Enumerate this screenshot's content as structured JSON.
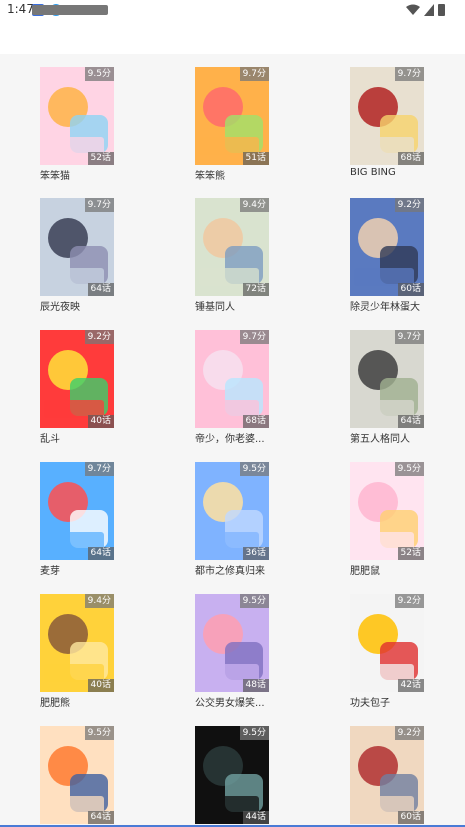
{
  "status_bar": {
    "time": "1:47",
    "app_icons": [
      "mail-icon",
      "bird-icon",
      "card-icon"
    ],
    "right_icons": [
      "wifi-icon",
      "signal-icon",
      "battery-icon"
    ]
  },
  "comics": [
    {
      "title": "笨笨猫",
      "score": "9.5分",
      "episodes": "52话",
      "colors": [
        "#ffd4e4",
        "#ffb347",
        "#8fd3f4"
      ]
    },
    {
      "title": "笨笨熊",
      "score": "9.7分",
      "episodes": "51话",
      "colors": [
        "#ffb14a",
        "#ff6b6b",
        "#a0e26a"
      ]
    },
    {
      "title": "BIG BING",
      "score": "9.7分",
      "episodes": "68话",
      "colors": [
        "#e8e0d0",
        "#b22222",
        "#f6d36b"
      ]
    },
    {
      "title": "辰光夜映",
      "score": "9.7分",
      "episodes": "64话",
      "colors": [
        "#c7d2e0",
        "#3a3f55",
        "#8d8fb2"
      ]
    },
    {
      "title": "锤基同人",
      "score": "9.4分",
      "episodes": "72话",
      "colors": [
        "#d9e3cf",
        "#f0c8a0",
        "#7d9cc1"
      ]
    },
    {
      "title": "除灵少年林蛋大",
      "score": "9.2分",
      "episodes": "60话",
      "colors": [
        "#5a7ac0",
        "#f0d0b0",
        "#303a55"
      ]
    },
    {
      "title": "乱斗",
      "score": "9.2分",
      "episodes": "40话",
      "colors": [
        "#ff3b3b",
        "#ffe23a",
        "#3ad16b"
      ]
    },
    {
      "title": "帝少，你老婆...",
      "score": "9.7分",
      "episodes": "68话",
      "colors": [
        "#ffc0d8",
        "#f7e0f0",
        "#b8e6ff"
      ]
    },
    {
      "title": "第五人格同人",
      "score": "9.7分",
      "episodes": "64话",
      "colors": [
        "#d8d8d0",
        "#404040",
        "#a0b090"
      ]
    },
    {
      "title": "麦芽",
      "score": "9.7分",
      "episodes": "64话",
      "colors": [
        "#58b0ff",
        "#ff5050",
        "#ffffff"
      ]
    },
    {
      "title": "都市之修真归来",
      "score": "9.5分",
      "episodes": "36话",
      "colors": [
        "#7fb3ff",
        "#ffe0a0",
        "#c0d8ff"
      ]
    },
    {
      "title": "肥肥鼠",
      "score": "9.5分",
      "episodes": "52话",
      "colors": [
        "#ffe4f0",
        "#ffb6d0",
        "#ffd070"
      ]
    },
    {
      "title": "肥肥熊",
      "score": "9.4分",
      "episodes": "40话",
      "colors": [
        "#ffd23a",
        "#8a5a3a",
        "#ffe9a0"
      ]
    },
    {
      "title": "公交男女爆笑...",
      "score": "9.5分",
      "episodes": "48话",
      "colors": [
        "#c8b0f0",
        "#ff9fb0",
        "#8070c0"
      ]
    },
    {
      "title": "功夫包子",
      "score": "9.2分",
      "episodes": "42话",
      "colors": [
        "#f4f4f4",
        "#ffc000",
        "#e03030"
      ]
    },
    {
      "title": "",
      "score": "9.5分",
      "episodes": "64话",
      "colors": [
        "#ffe0c0",
        "#ff7a30",
        "#4060a0"
      ]
    },
    {
      "title": "",
      "score": "9.5分",
      "episodes": "44话",
      "colors": [
        "#101010",
        "#2a3a3a",
        "#70a0a0"
      ]
    },
    {
      "title": "",
      "score": "9.2分",
      "episodes": "60话",
      "colors": [
        "#f0d8c0",
        "#b03030",
        "#7080a0"
      ]
    }
  ]
}
